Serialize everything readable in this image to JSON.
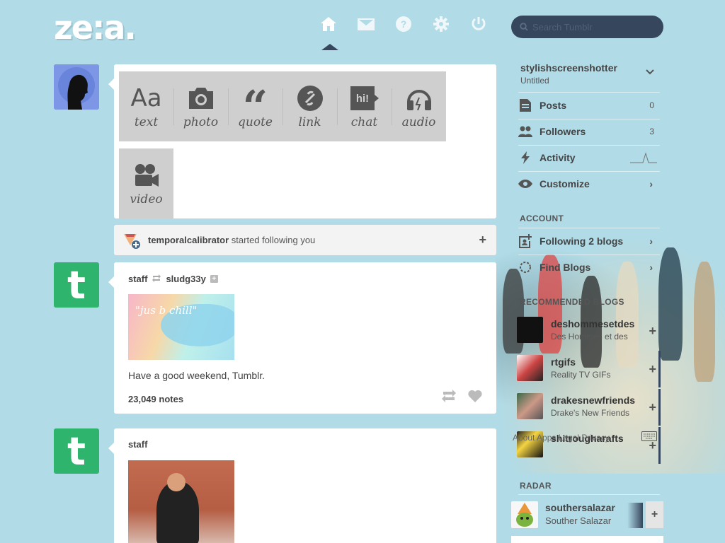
{
  "logo": "ze:a.",
  "search": {
    "placeholder": "Search Tumblr"
  },
  "nav": {
    "icons": [
      "home-icon",
      "mail-icon",
      "help-icon",
      "gear-icon",
      "power-icon"
    ],
    "active": "home"
  },
  "post_types": [
    {
      "glyph": "Aa",
      "label": "text"
    },
    {
      "glyph": "camera",
      "label": "photo"
    },
    {
      "glyph": "“",
      "label": "quote"
    },
    {
      "glyph": "link",
      "label": "link"
    },
    {
      "glyph": "hi!",
      "label": "chat"
    },
    {
      "glyph": "headphones",
      "label": "audio"
    },
    {
      "glyph": "video-camera",
      "label": "video"
    }
  ],
  "notification": {
    "user": "temporalcalibrator",
    "text": "started following you",
    "action": "+"
  },
  "posts": [
    {
      "author": "staff",
      "reblogged_from": "sludg33y",
      "image_text": "\"jus b chill\"",
      "caption": "Have a good weekend, Tumblr.",
      "notes": "23,049 notes"
    },
    {
      "author": "staff"
    }
  ],
  "sidebar": {
    "blog_name": "stylishscreenshotter",
    "blog_title": "Untitled",
    "items": [
      {
        "label": "Posts",
        "count": "0",
        "icon": "posts-icon"
      },
      {
        "label": "Followers",
        "count": "3",
        "icon": "followers-icon"
      },
      {
        "label": "Activity",
        "icon": "activity-icon"
      },
      {
        "label": "Customize",
        "icon": "eye-icon"
      }
    ],
    "account_header": "ACCOUNT",
    "account_items": [
      {
        "label": "Following 2 blogs"
      },
      {
        "label": "Find Blogs"
      }
    ],
    "recommended_header": "RECOMMENDED BLOGS",
    "recommended": [
      {
        "name": "deshommesetdes",
        "desc": "Des Hommes et des"
      },
      {
        "name": "rtgifs",
        "desc": "Reality TV GIFs"
      },
      {
        "name": "drakesnewfriends",
        "desc": "Drake's New Friends"
      },
      {
        "name": "shitrougharafts",
        "desc": ""
      }
    ],
    "footer": "About  Apps  Legal  Privacy",
    "radar_header": "RADAR",
    "radar": {
      "name": "southersalazar",
      "desc": "Souther Salazar"
    }
  },
  "colors": {
    "background": "#b0dbe7",
    "navy": "#36465d",
    "tumblr_green": "#2fb46e"
  }
}
